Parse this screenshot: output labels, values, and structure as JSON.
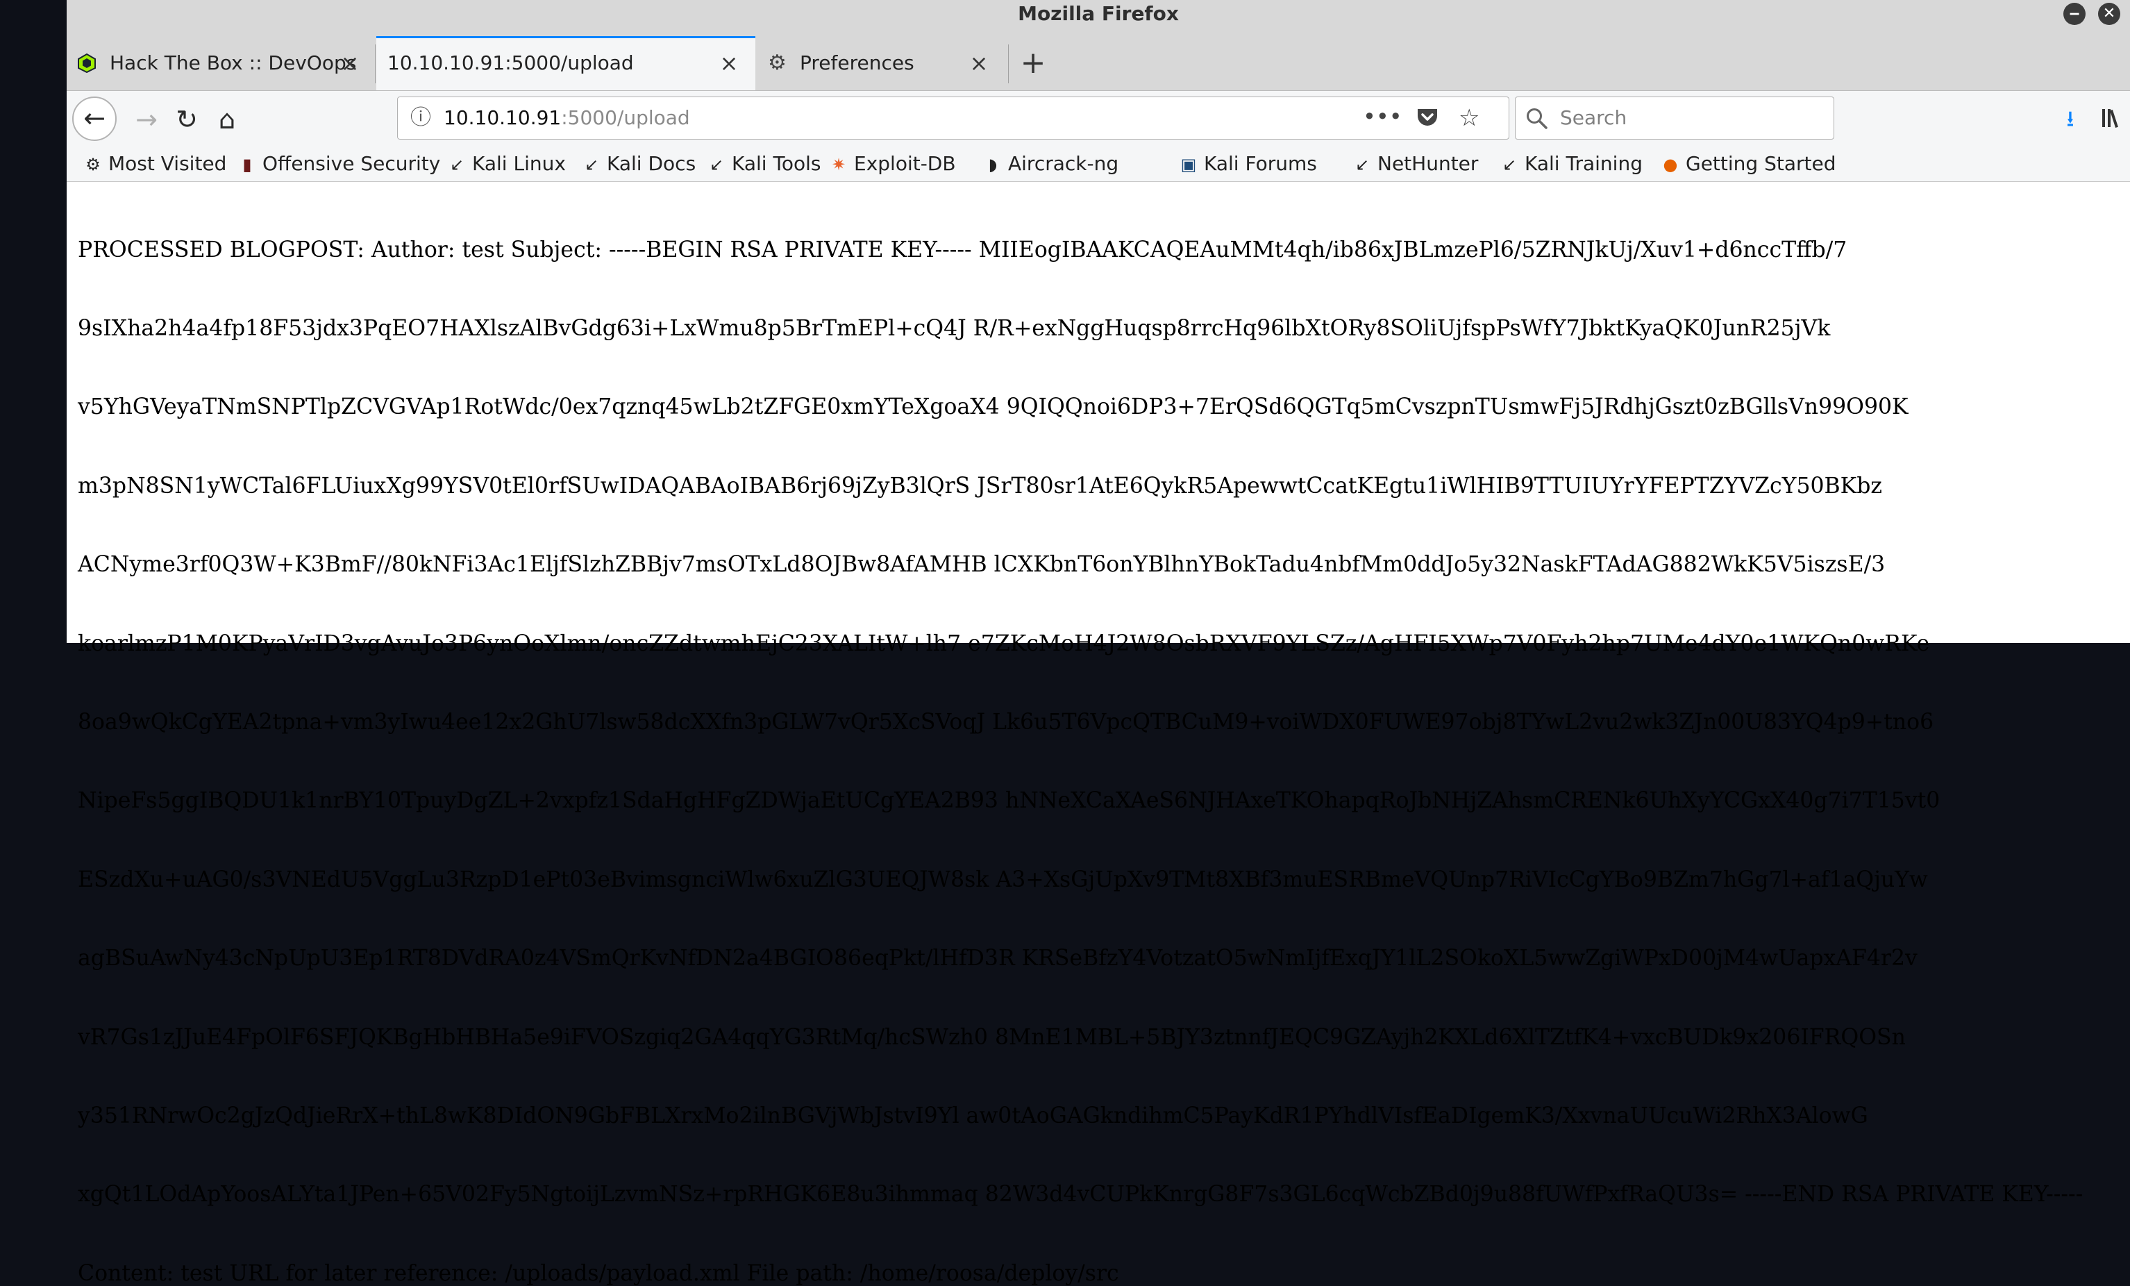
{
  "window": {
    "title": "Mozilla Firefox"
  },
  "tabs": [
    {
      "label": "Hack The Box :: DevOops",
      "icon": "hackthebox-icon"
    },
    {
      "label": "10.10.10.91:5000/upload",
      "active": true
    },
    {
      "label": "Preferences",
      "icon": "gear-icon"
    }
  ],
  "url": {
    "host": "10.10.10.91",
    "rest": ":5000/upload"
  },
  "search": {
    "placeholder": "Search"
  },
  "bookmarks": [
    {
      "label": "Most Visited",
      "icon": "gear-icon"
    },
    {
      "label": "Offensive Security",
      "icon": "offsec-icon"
    },
    {
      "label": "Kali Linux",
      "icon": "kali-icon"
    },
    {
      "label": "Kali Docs",
      "icon": "kali-icon"
    },
    {
      "label": "Kali Tools",
      "icon": "kali-icon"
    },
    {
      "label": "Exploit-DB",
      "icon": "exploitdb-icon"
    },
    {
      "label": "Aircrack-ng",
      "icon": "aircrack-icon"
    },
    {
      "label": "Kali Forums",
      "icon": "kali-forums-icon"
    },
    {
      "label": "NetHunter",
      "icon": "kali-icon"
    },
    {
      "label": "Kali Training",
      "icon": "kali-icon"
    },
    {
      "label": "Getting Started",
      "icon": "firefox-icon"
    }
  ],
  "content": {
    "lines": [
      "PROCESSED BLOGPOST: Author: test Subject: -----BEGIN RSA PRIVATE KEY----- MIIEogIBAAKCAQEAuMMt4qh/ib86xJBLmzePl6/5ZRNJkUj/Xuv1+d6nccTffb/7",
      "9sIXha2h4a4fp18F53jdx3PqEO7HAXlszAlBvGdg63i+LxWmu8p5BrTmEPl+cQ4J R/R+exNggHuqsp8rrcHq96lbXtORy8SOliUjfspPsWfY7JbktKyaQK0JunR25jVk",
      "v5YhGVeyaTNmSNPTlpZCVGVAp1RotWdc/0ex7qznq45wLb2tZFGE0xmYTeXgoaX4 9QIQQnoi6DP3+7ErQSd6QGTq5mCvszpnTUsmwFj5JRdhjGszt0zBGllsVn99O90K",
      "m3pN8SN1yWCTal6FLUiuxXg99YSV0tEl0rfSUwIDAQABAoIBAB6rj69jZyB3lQrS JSrT80sr1AtE6QykR5ApewwtCcatKEgtu1iWlHIB9TTUIUYrYFEPTZYVZcY50BKbz",
      "ACNyme3rf0Q3W+K3BmF//80kNFi3Ac1EljfSlzhZBBjv7msOTxLd8OJBw8AfAMHB lCXKbnT6onYBlhnYBokTadu4nbfMm0ddJo5y32NaskFTAdAG882WkK5V5iszsE/3",
      "koarlmzP1M0KPyaVrID3vgAvuJo3P6ynOoXlmn/oncZZdtwmhEjC23XALItW+lh7 e7ZKcMoH4J2W8OsbRXVF9YLSZz/AgHFI5XWp7V0Fyh2hp7UMe4dY0e1WKQn0wRKe",
      "8oa9wQkCgYEA2tpna+vm3yIwu4ee12x2GhU7lsw58dcXXfn3pGLW7vQr5XcSVoqJ Lk6u5T6VpcQTBCuM9+voiWDX0FUWE97obj8TYwL2vu2wk3ZJn00U83YQ4p9+tno6",
      "NipeFs5ggIBQDU1k1nrBY10TpuyDgZL+2vxpfz1SdaHgHFgZDWjaEtUCgYEA2B93 hNNeXCaXAeS6NJHAxeTKOhapqRoJbNHjZAhsmCRENk6UhXyYCGxX40g7i7T15vt0",
      "ESzdXu+uAG0/s3VNEdU5VggLu3RzpD1ePt03eBvimsgnciWlw6xuZlG3UEQJW8sk A3+XsGjUpXv9TMt8XBf3muESRBmeVQUnp7RiVIcCgYBo9BZm7hGg7l+af1aQjuYw",
      "agBSuAwNy43cNpUpU3Ep1RT8DVdRA0z4VSmQrKvNfDN2a4BGIO86eqPkt/lHfD3R KRSeBfzY4VotzatO5wNmIjfExqJY1lL2SOkoXL5wwZgiWPxD00jM4wUapxAF4r2v",
      "vR7Gs1zJJuE4FpOlF6SFJQKBgHbHBHa5e9iFVOSzgiq2GA4qqYG3RtMq/hcSWzh0 8MnE1MBL+5BJY3ztnnfJEQC9GZAyjh2KXLd6XlTZtfK4+vxcBUDk9x206IFRQOSn",
      "y351RNrwOc2gJzQdJieRrX+thL8wK8DIdON9GbFBLXrxMo2ilnBGVjWbJstvI9Yl aw0tAoGAGkndihmC5PayKdR1PYhdlVIsfEaDIgemK3/XxvnaUUcuWi2RhX3AlowG",
      "xgQt1LOdApYoosALYta1JPen+65V02Fy5NgtoijLzvmNSz+rpRHGK6E8u3ihmmaq 82W3d4vCUPkKnrgG8F7s3GL6cqWcbZBd0j9u88fUWfPxfRaQU3s= -----END RSA PRIVATE KEY-----",
      "Content: test URL for later reference: /uploads/payload.xml File path: /home/roosa/deploy/src"
    ]
  },
  "colors": {
    "accent": "#0a84ff",
    "download_arrow": "#0a84ff",
    "desktop": "#0d1018"
  }
}
